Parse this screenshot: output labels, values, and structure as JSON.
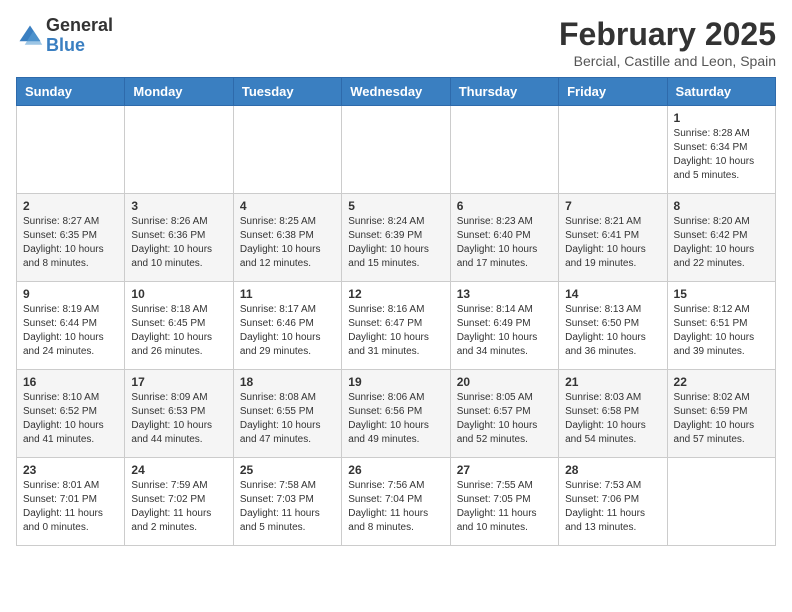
{
  "header": {
    "logo": {
      "general": "General",
      "blue": "Blue"
    },
    "month": "February 2025",
    "location": "Bercial, Castille and Leon, Spain"
  },
  "weekdays": [
    "Sunday",
    "Monday",
    "Tuesday",
    "Wednesday",
    "Thursday",
    "Friday",
    "Saturday"
  ],
  "weeks": [
    [
      {
        "day": null,
        "info": ""
      },
      {
        "day": null,
        "info": ""
      },
      {
        "day": null,
        "info": ""
      },
      {
        "day": null,
        "info": ""
      },
      {
        "day": null,
        "info": ""
      },
      {
        "day": null,
        "info": ""
      },
      {
        "day": "1",
        "info": "Sunrise: 8:28 AM\nSunset: 6:34 PM\nDaylight: 10 hours and 5 minutes."
      }
    ],
    [
      {
        "day": "2",
        "info": "Sunrise: 8:27 AM\nSunset: 6:35 PM\nDaylight: 10 hours and 8 minutes."
      },
      {
        "day": "3",
        "info": "Sunrise: 8:26 AM\nSunset: 6:36 PM\nDaylight: 10 hours and 10 minutes."
      },
      {
        "day": "4",
        "info": "Sunrise: 8:25 AM\nSunset: 6:38 PM\nDaylight: 10 hours and 12 minutes."
      },
      {
        "day": "5",
        "info": "Sunrise: 8:24 AM\nSunset: 6:39 PM\nDaylight: 10 hours and 15 minutes."
      },
      {
        "day": "6",
        "info": "Sunrise: 8:23 AM\nSunset: 6:40 PM\nDaylight: 10 hours and 17 minutes."
      },
      {
        "day": "7",
        "info": "Sunrise: 8:21 AM\nSunset: 6:41 PM\nDaylight: 10 hours and 19 minutes."
      },
      {
        "day": "8",
        "info": "Sunrise: 8:20 AM\nSunset: 6:42 PM\nDaylight: 10 hours and 22 minutes."
      }
    ],
    [
      {
        "day": "9",
        "info": "Sunrise: 8:19 AM\nSunset: 6:44 PM\nDaylight: 10 hours and 24 minutes."
      },
      {
        "day": "10",
        "info": "Sunrise: 8:18 AM\nSunset: 6:45 PM\nDaylight: 10 hours and 26 minutes."
      },
      {
        "day": "11",
        "info": "Sunrise: 8:17 AM\nSunset: 6:46 PM\nDaylight: 10 hours and 29 minutes."
      },
      {
        "day": "12",
        "info": "Sunrise: 8:16 AM\nSunset: 6:47 PM\nDaylight: 10 hours and 31 minutes."
      },
      {
        "day": "13",
        "info": "Sunrise: 8:14 AM\nSunset: 6:49 PM\nDaylight: 10 hours and 34 minutes."
      },
      {
        "day": "14",
        "info": "Sunrise: 8:13 AM\nSunset: 6:50 PM\nDaylight: 10 hours and 36 minutes."
      },
      {
        "day": "15",
        "info": "Sunrise: 8:12 AM\nSunset: 6:51 PM\nDaylight: 10 hours and 39 minutes."
      }
    ],
    [
      {
        "day": "16",
        "info": "Sunrise: 8:10 AM\nSunset: 6:52 PM\nDaylight: 10 hours and 41 minutes."
      },
      {
        "day": "17",
        "info": "Sunrise: 8:09 AM\nSunset: 6:53 PM\nDaylight: 10 hours and 44 minutes."
      },
      {
        "day": "18",
        "info": "Sunrise: 8:08 AM\nSunset: 6:55 PM\nDaylight: 10 hours and 47 minutes."
      },
      {
        "day": "19",
        "info": "Sunrise: 8:06 AM\nSunset: 6:56 PM\nDaylight: 10 hours and 49 minutes."
      },
      {
        "day": "20",
        "info": "Sunrise: 8:05 AM\nSunset: 6:57 PM\nDaylight: 10 hours and 52 minutes."
      },
      {
        "day": "21",
        "info": "Sunrise: 8:03 AM\nSunset: 6:58 PM\nDaylight: 10 hours and 54 minutes."
      },
      {
        "day": "22",
        "info": "Sunrise: 8:02 AM\nSunset: 6:59 PM\nDaylight: 10 hours and 57 minutes."
      }
    ],
    [
      {
        "day": "23",
        "info": "Sunrise: 8:01 AM\nSunset: 7:01 PM\nDaylight: 11 hours and 0 minutes."
      },
      {
        "day": "24",
        "info": "Sunrise: 7:59 AM\nSunset: 7:02 PM\nDaylight: 11 hours and 2 minutes."
      },
      {
        "day": "25",
        "info": "Sunrise: 7:58 AM\nSunset: 7:03 PM\nDaylight: 11 hours and 5 minutes."
      },
      {
        "day": "26",
        "info": "Sunrise: 7:56 AM\nSunset: 7:04 PM\nDaylight: 11 hours and 8 minutes."
      },
      {
        "day": "27",
        "info": "Sunrise: 7:55 AM\nSunset: 7:05 PM\nDaylight: 11 hours and 10 minutes."
      },
      {
        "day": "28",
        "info": "Sunrise: 7:53 AM\nSunset: 7:06 PM\nDaylight: 11 hours and 13 minutes."
      },
      {
        "day": null,
        "info": ""
      }
    ]
  ]
}
